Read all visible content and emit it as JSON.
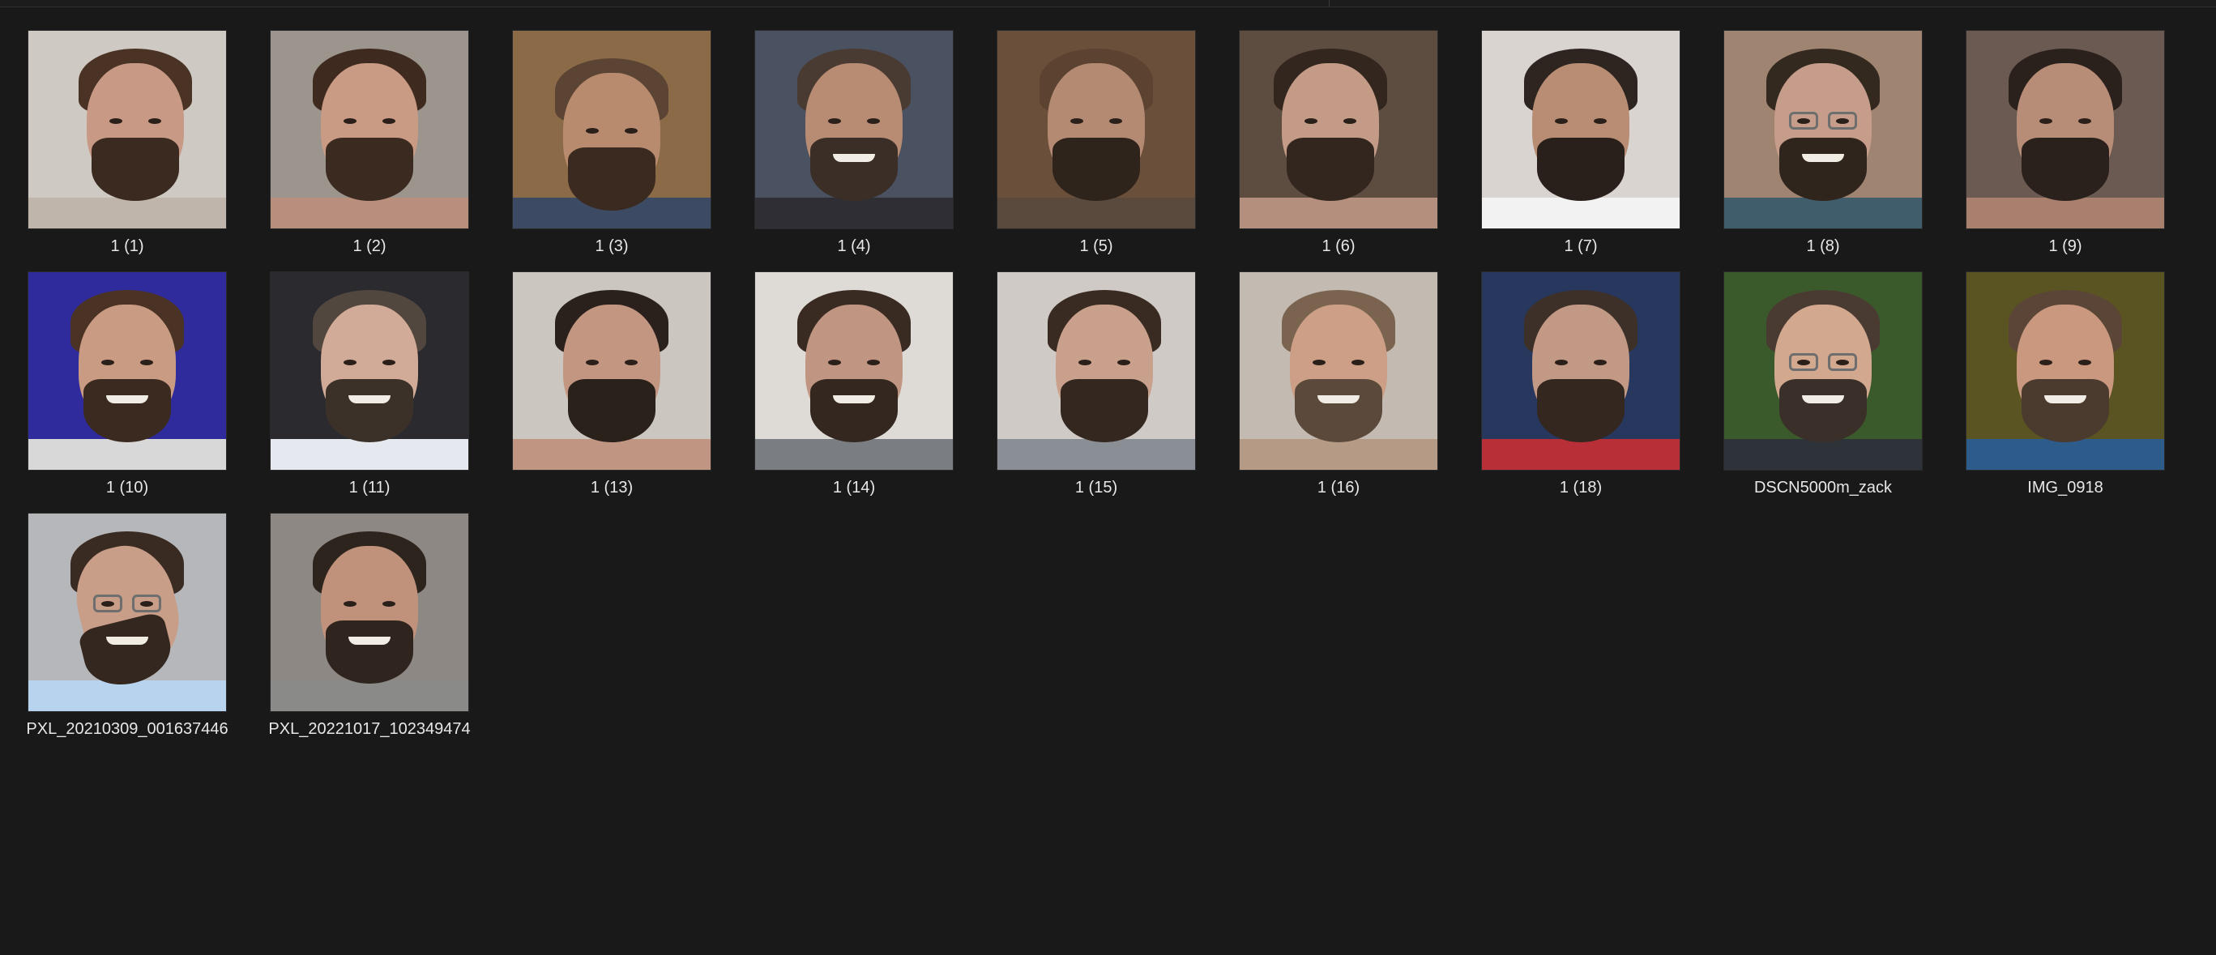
{
  "explorer": {
    "files": [
      {
        "name": "1 (1)",
        "bg": "#cfc9c3",
        "skin": "#c89a86",
        "hair": "#4a3324",
        "beard": "#3a2a20",
        "shirt": "#bfb5aa",
        "smile": false,
        "glasses": false,
        "turn": "right"
      },
      {
        "name": "1 (2)",
        "bg": "#9c958e",
        "skin": "#c99a84",
        "hair": "#3e2a1e",
        "beard": "#3b2a20",
        "shirt": "#b88f7c",
        "smile": false,
        "glasses": false,
        "turn": "none"
      },
      {
        "name": "1 (3)",
        "bg": "#8a6a47",
        "skin": "#b88a6e",
        "hair": "#5b4433",
        "beard": "#3a2a20",
        "shirt": "#3c4b63",
        "smile": false,
        "glasses": false,
        "turn": "down"
      },
      {
        "name": "1 (4)",
        "bg": "#4a5160",
        "skin": "#b88b73",
        "hair": "#4a3b32",
        "beard": "#3a2e27",
        "shirt": "#2e2e34",
        "smile": true,
        "glasses": false,
        "turn": "none"
      },
      {
        "name": "1 (5)",
        "bg": "#6a4f3a",
        "skin": "#b48a72",
        "hair": "#5b4231",
        "beard": "#2f241c",
        "shirt": "#5a4a3e",
        "smile": false,
        "glasses": false,
        "turn": "none"
      },
      {
        "name": "1 (6)",
        "bg": "#5d4c40",
        "skin": "#c39b86",
        "hair": "#33261e",
        "beard": "#33261e",
        "shirt": "#b58f7d",
        "smile": false,
        "glasses": false,
        "turn": "left"
      },
      {
        "name": "1 (7)",
        "bg": "#d9d4cf",
        "skin": "#b98d74",
        "hair": "#2e2520",
        "beard": "#2a201b",
        "shirt": "#f2f2f2",
        "smile": false,
        "glasses": false,
        "turn": "none"
      },
      {
        "name": "1 (8)",
        "bg": "#a08472",
        "skin": "#c59d8a",
        "hair": "#33291f",
        "beard": "#30251d",
        "shirt": "#3f5d6b",
        "smile": true,
        "glasses": true,
        "turn": "none"
      },
      {
        "name": "1 (9)",
        "bg": "#6b5a51",
        "skin": "#b88d78",
        "hair": "#2a201c",
        "beard": "#2a201c",
        "shirt": "#a8806d",
        "smile": false,
        "glasses": false,
        "turn": "none"
      },
      {
        "name": "1 (10)",
        "bg": "#2f2b9c",
        "skin": "#c99b82",
        "hair": "#4a3324",
        "beard": "#3b2a20",
        "shirt": "#d8d8d8",
        "smile": true,
        "glasses": false,
        "turn": "none"
      },
      {
        "name": "1 (11)",
        "bg": "#2b2a2e",
        "skin": "#d2ab98",
        "hair": "#52473f",
        "beard": "#3b3129",
        "shirt": "#e5e9ef",
        "smile": true,
        "glasses": false,
        "turn": "none"
      },
      {
        "name": "1 (13)",
        "bg": "#cbc6c0",
        "skin": "#c39682",
        "hair": "#2b211c",
        "beard": "#2a211b",
        "shirt": "#c09683",
        "smile": false,
        "glasses": false,
        "turn": "none"
      },
      {
        "name": "1 (14)",
        "bg": "#dedad6",
        "skin": "#c09682",
        "hair": "#3a2b22",
        "beard": "#33271f",
        "shirt": "#7a7d82",
        "smile": true,
        "glasses": false,
        "turn": "none"
      },
      {
        "name": "1 (15)",
        "bg": "#cfcac6",
        "skin": "#c9a08b",
        "hair": "#3a2b22",
        "beard": "#33271f",
        "shirt": "#8a8f95",
        "smile": false,
        "glasses": false,
        "turn": "right"
      },
      {
        "name": "1 (16)",
        "bg": "#c3bab1",
        "skin": "#cc9f86",
        "hair": "#7a6450",
        "beard": "#5b4a3b",
        "shirt": "#b59a85",
        "smile": true,
        "glasses": false,
        "turn": "none"
      },
      {
        "name": "1 (18)",
        "bg": "#27375e",
        "skin": "#c29985",
        "hair": "#3c3029",
        "beard": "#33271f",
        "shirt": "#b82f38",
        "smile": false,
        "glasses": false,
        "turn": "none"
      },
      {
        "name": "DSCN5000m_zack",
        "bg": "#3b5a2c",
        "skin": "#d2a98f",
        "hair": "#4a3b32",
        "beard": "#3b3029",
        "shirt": "#2d3338",
        "smile": true,
        "glasses": true,
        "turn": "none"
      },
      {
        "name": "IMG_0918",
        "bg": "#5a5422",
        "skin": "#c9987f",
        "hair": "#5a4536",
        "beard": "#4b3a2e",
        "shirt": "#2d5b8a",
        "smile": true,
        "glasses": false,
        "turn": "none"
      },
      {
        "name": "PXL_20210309_001637446",
        "bg": "#b5b7ba",
        "skin": "#c99e88",
        "hair": "#3a2b22",
        "beard": "#33271f",
        "shirt": "#b7d3ee",
        "smile": true,
        "glasses": true,
        "turn": "tilt"
      },
      {
        "name": "PXL_20221017_102349474",
        "bg": "#8d8884",
        "skin": "#c0927c",
        "hair": "#2e241e",
        "beard": "#2f251e",
        "shirt": "#8a8a88",
        "smile": true,
        "glasses": false,
        "turn": "none"
      }
    ]
  }
}
